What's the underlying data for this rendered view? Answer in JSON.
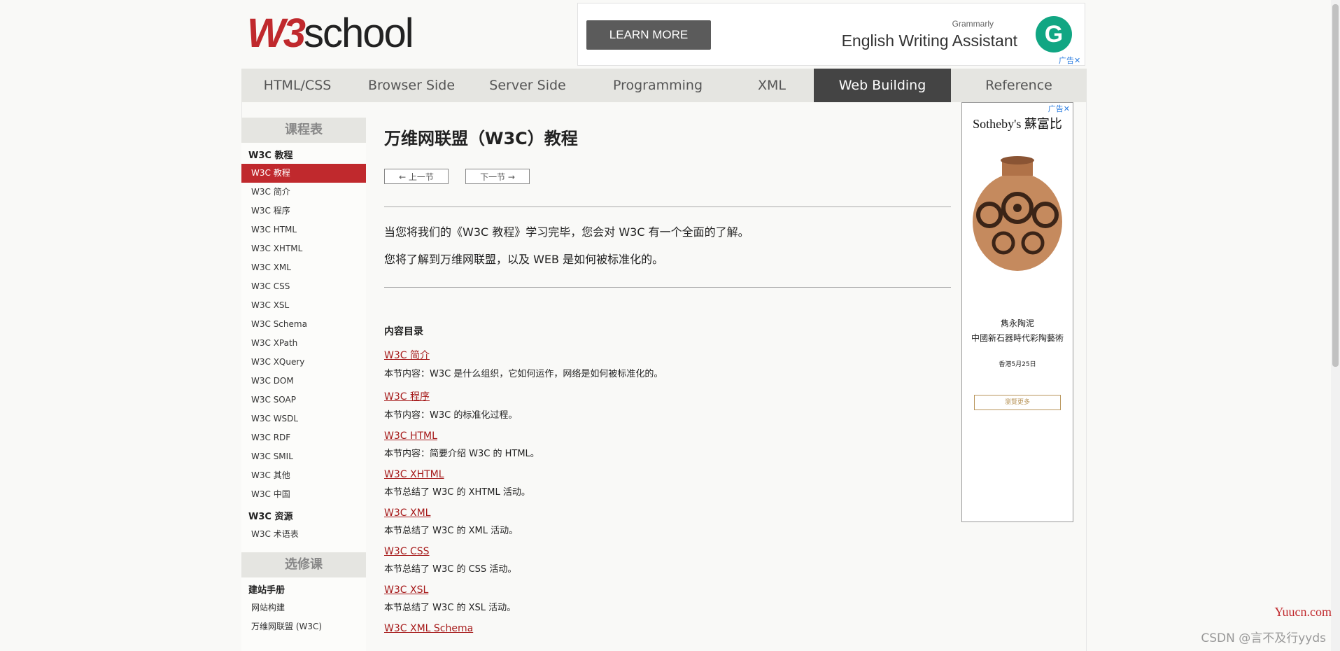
{
  "logo": {
    "w3": "W3",
    "school": "school"
  },
  "top_ad": {
    "button": "LEARN MORE",
    "brand": "Grammarly",
    "product": "English Writing Assistant",
    "ad_label": "广告",
    "close": "✕",
    "g_letter": "G"
  },
  "nav": [
    {
      "label": "HTML/CSS",
      "active": false
    },
    {
      "label": "Browser Side",
      "active": false
    },
    {
      "label": "Server Side",
      "active": false
    },
    {
      "label": "Programming",
      "active": false
    },
    {
      "label": "XML",
      "active": false
    },
    {
      "label": "Web Building",
      "active": true
    },
    {
      "label": "Reference",
      "active": false
    }
  ],
  "sidebar": {
    "head1": "课程表",
    "section1": "W3C 教程",
    "items1": [
      "W3C 教程",
      "W3C 简介",
      "W3C 程序",
      "W3C HTML",
      "W3C XHTML",
      "W3C XML",
      "W3C CSS",
      "W3C XSL",
      "W3C Schema",
      "W3C XPath",
      "W3C XQuery",
      "W3C DOM",
      "W3C SOAP",
      "W3C WSDL",
      "W3C RDF",
      "W3C SMIL",
      "W3C 其他",
      "W3C 中国"
    ],
    "section2": "W3C 资源",
    "items2": [
      "W3C 术语表"
    ],
    "head2": "选修课",
    "section3": "建站手册",
    "items3": [
      "网站构建",
      "万维网联盟 (W3C)"
    ]
  },
  "main": {
    "title": "万维网联盟（W3C）教程",
    "prev": "← 上一节",
    "next": "下一节 →",
    "intro1": "当您将我们的《W3C 教程》学习完毕，您会对 W3C 有一个全面的了解。",
    "intro2": "您将了解到万维网联盟，以及 WEB 是如何被标准化的。",
    "toc_title": "内容目录",
    "toc": [
      {
        "link": "W3C 简介",
        "desc": "本节内容：W3C 是什么组织，它如何运作，网络是如何被标准化的。"
      },
      {
        "link": "W3C 程序",
        "desc": "本节内容：W3C 的标准化过程。"
      },
      {
        "link": "W3C HTML",
        "desc": "本节内容：简要介绍 W3C 的 HTML。"
      },
      {
        "link": "W3C XHTML",
        "desc": "本节总结了 W3C 的 XHTML 活动。"
      },
      {
        "link": "W3C XML",
        "desc": "本节总结了 W3C 的 XML 活动。"
      },
      {
        "link": "W3C CSS",
        "desc": "本节总结了 W3C 的 CSS 活动。"
      },
      {
        "link": "W3C XSL",
        "desc": "本节总结了 W3C 的 XSL 活动。"
      },
      {
        "link": "W3C XML Schema",
        "desc": ""
      }
    ]
  },
  "right_ad": {
    "ad_label": "广告",
    "close": "✕",
    "brand": "Sotheby's 蘇富比",
    "line1": "雋永陶泥",
    "line2": "中國新石器時代彩陶藝術",
    "line3": "香港5月25日",
    "button": "瀏覽更多"
  },
  "watermark": {
    "site": "Yuucn.com",
    "credit": "CSDN @言不及行yyds"
  },
  "colors": {
    "accent": "#c0292d",
    "nav_active": "#444444",
    "nav_bg": "#e5e5e1"
  }
}
